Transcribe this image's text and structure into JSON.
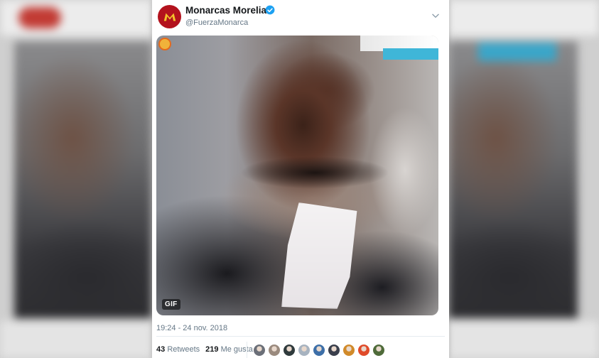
{
  "tweet": {
    "display_name": "Monarcas Morelia",
    "handle": "@FuerzaMonarca",
    "verified": true,
    "media_badge": "GIF",
    "timestamp": "19:24 - 24 nov. 2018",
    "retweets_count": "43",
    "retweets_label": "Retweets",
    "likes_count": "219",
    "likes_label": "Me gusta"
  },
  "likers": [
    {
      "icon": "avatar-1",
      "color": "#6b6f78"
    },
    {
      "icon": "avatar-2",
      "color": "#9a8a7e"
    },
    {
      "icon": "avatar-3",
      "color": "#2f3a3c"
    },
    {
      "icon": "avatar-4",
      "color": "#a7b3c0"
    },
    {
      "icon": "avatar-5",
      "color": "#3d6fa8"
    },
    {
      "icon": "avatar-6",
      "color": "#3a3f4c"
    },
    {
      "icon": "avatar-7",
      "color": "#d18a2a"
    },
    {
      "icon": "avatar-8",
      "color": "#e04b2a"
    },
    {
      "icon": "avatar-9",
      "color": "#4f6b3a"
    }
  ],
  "colors": {
    "brand_red": "#b3121d",
    "verified_blue": "#1da1f2",
    "muted_text": "#657786",
    "primary_text": "#14171a"
  }
}
